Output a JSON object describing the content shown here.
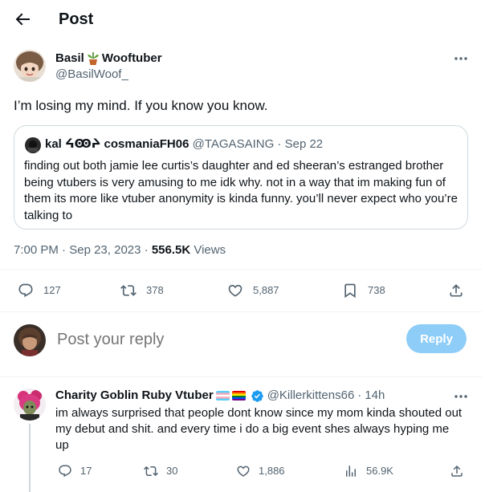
{
  "header": {
    "title": "Post",
    "back_icon": "arrow-left-icon"
  },
  "post": {
    "author_name": "Basil",
    "author_name_suffix": "Wooftuber",
    "author_emoji": "potted-plant-icon",
    "author_handle": "@BasilWoof_",
    "text": "I’m losing my mind. If you know you know.",
    "quote": {
      "name": "kal ᔦꙬᔨ cosmaniaFH06",
      "handle": "@TAGASAING",
      "separator": "·",
      "date": "Sep 22",
      "text": "finding out both jamie lee curtis’s daughter and ed sheeran’s estranged brother being vtubers is very amusing to me idk why. not in a way that im making fun of them its more like vtuber anonymity is kinda funny. you’ll never expect who you’re talking to"
    },
    "meta": {
      "time": "7:00 PM",
      "sep1": "·",
      "date": "Sep 23, 2023",
      "sep2": "·",
      "views_count": "556.5K",
      "views_label": "Views"
    },
    "actions": {
      "replies": "127",
      "reposts": "378",
      "likes": "5,887",
      "bookmarks": "738"
    }
  },
  "composer": {
    "placeholder": "Post your reply",
    "button_label": "Reply"
  },
  "comment": {
    "author_name": "Charity Goblin Ruby Vtuber",
    "handle": "@Killerkittens66",
    "separator": "·",
    "time": "14h",
    "text": "im always surprised that people dont know since my mom kinda shouted out my debut and shit. and every time i do a big event shes always hyping me up",
    "actions": {
      "replies": "17",
      "reposts": "30",
      "likes": "1,886",
      "views": "56.9K"
    }
  },
  "colors": {
    "text": "#0f1419",
    "muted": "#536471",
    "reply_button": "#8ecdf8",
    "verified": "#1d9bf0",
    "border": "#cfd9de"
  }
}
